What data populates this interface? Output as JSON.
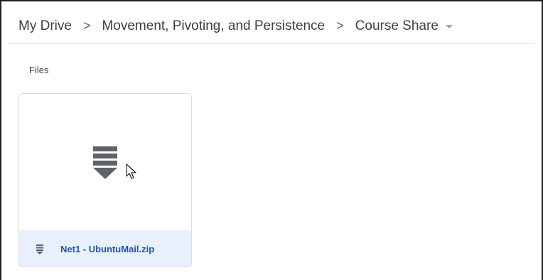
{
  "breadcrumb": {
    "items": [
      {
        "label": "My Drive"
      },
      {
        "label": "Movement, Pivoting, and Persistence"
      },
      {
        "label": "Course Share"
      }
    ],
    "separator": ">",
    "dropdown_icon": "chevron-down-icon"
  },
  "files_section": {
    "label": "Files",
    "files": [
      {
        "name": "Net1 - UbuntuMail.zip",
        "type_icon": "zip-file-icon",
        "selected": true
      }
    ]
  },
  "colors": {
    "selected_bg": "#e8f0fe",
    "file_name_text": "#1a56b8",
    "icon_gray": "#5f6368"
  }
}
